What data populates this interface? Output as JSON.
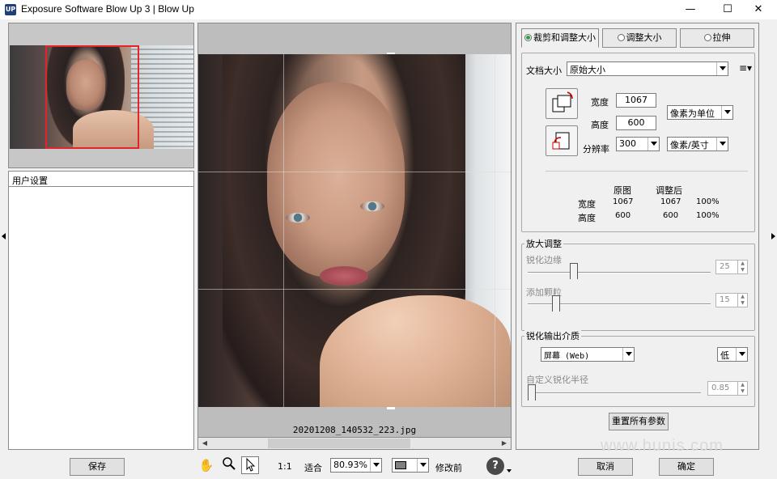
{
  "window": {
    "title": "Exposure Software Blow Up 3 | Blow Up",
    "app_icon_text": "UP",
    "minimize_glyph": "—",
    "maximize_glyph": "☐",
    "close_glyph": "✕"
  },
  "left_panel": {
    "preset_header": "用户设置"
  },
  "canvas": {
    "filename": "20201208_140532_223.jpg"
  },
  "tabs": [
    {
      "label": "裁剪和调整大小",
      "active": true
    },
    {
      "label": "调整大小",
      "active": false
    },
    {
      "label": "拉伸",
      "active": false
    }
  ],
  "doc_size": {
    "label": "文档大小",
    "value": "原始大小",
    "width_label": "宽度",
    "width_value": "1067",
    "height_label": "高度",
    "height_value": "600",
    "resolution_label": "分辨率",
    "resolution_value": "300",
    "unit_value": "像素为单位",
    "resolution_unit_value": "像素/英寸"
  },
  "size_table": {
    "col_original": "原图",
    "col_adjusted": "调整后",
    "rows": [
      {
        "label": "宽度",
        "original": "1067",
        "adjusted": "1067",
        "percent": "100%"
      },
      {
        "label": "高度",
        "original": "600",
        "adjusted": "600",
        "percent": "100%"
      }
    ]
  },
  "enlarge": {
    "title": "放大调整",
    "sharpen_label": "锐化边缘",
    "sharpen_value": "25",
    "grain_label": "添加颗粒",
    "grain_value": "15"
  },
  "output": {
    "title": "锐化输出介质",
    "medium_value": "屏幕 (Web)",
    "level_value": "低",
    "radius_label": "自定义锐化半径",
    "radius_value": "0.85"
  },
  "reset_button": "重置所有参数",
  "bottom": {
    "save": "保存",
    "zoom_1_1": "1:1",
    "fit": "适合",
    "zoom_value": "80.93%",
    "before_label": "修改前",
    "help_glyph": "?",
    "cancel": "取消",
    "ok": "确定"
  },
  "watermark": "www.hunis.com",
  "colors": {
    "selection_frame": "#e0262a",
    "radio_active": "#2aa33a"
  }
}
